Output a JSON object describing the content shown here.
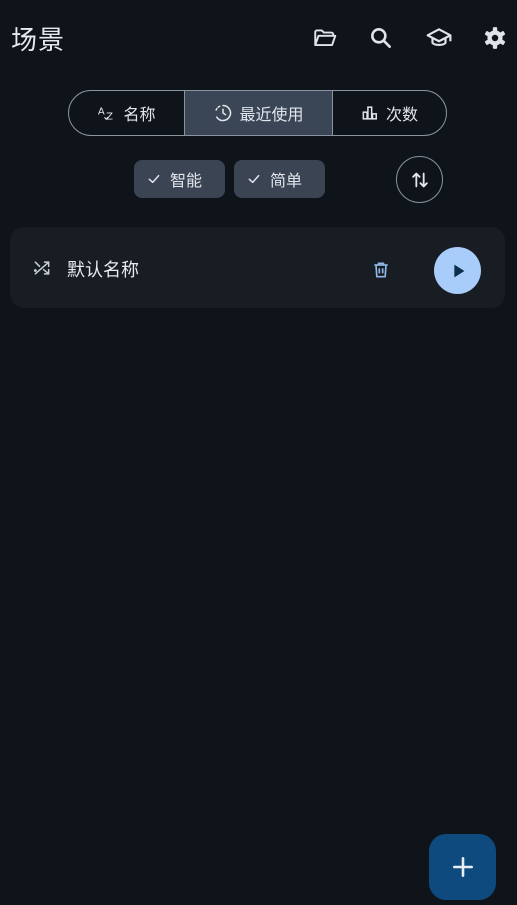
{
  "appbar": {
    "title": "场景",
    "icons": [
      "folder-open-icon",
      "search-icon",
      "school-icon",
      "settings-icon"
    ]
  },
  "sort_segments": [
    {
      "label": "名称",
      "icon": "sort-alpha-icon",
      "selected": false
    },
    {
      "label": "最近使用",
      "icon": "recent-history-icon",
      "selected": true
    },
    {
      "label": "次数",
      "icon": "bar-chart-icon",
      "selected": false
    }
  ],
  "filter_chips": [
    {
      "label": "智能",
      "checked": true
    },
    {
      "label": "简单",
      "checked": true
    }
  ],
  "scene_list": [
    {
      "title": "默认名称",
      "icon": "shuffle-icon"
    }
  ],
  "colors": {
    "background": "#0f141b",
    "card": "#181d24",
    "segment_selected": "#3a4656",
    "chip": "#3a4452",
    "play_button": "#a9cdfa",
    "fab": "#0e4a7e",
    "accent_icon": "#8fb8e6"
  }
}
